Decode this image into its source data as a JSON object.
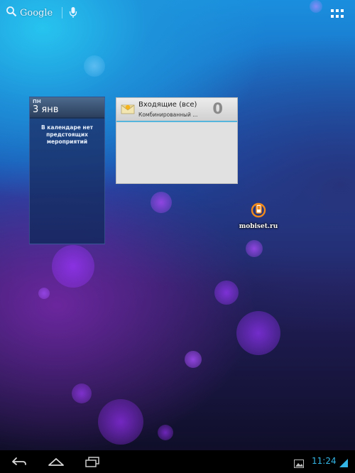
{
  "search": {
    "label": "Google"
  },
  "calendar": {
    "day_of_week": "ПН",
    "date": "3 янв",
    "empty_message": "В календаре нет предстоящих мероприятий"
  },
  "email": {
    "title": "Входящие (все)",
    "account": "Комбинированный ...",
    "unread_count": "0"
  },
  "watermark": {
    "text": "mobiset.ru"
  },
  "status": {
    "time": "11:24"
  },
  "navigation": {
    "items": [
      "back-icon",
      "home-icon",
      "recent-apps-icon"
    ]
  },
  "colors": {
    "accent": "#33b5e5",
    "nav_bg": "#000000"
  }
}
